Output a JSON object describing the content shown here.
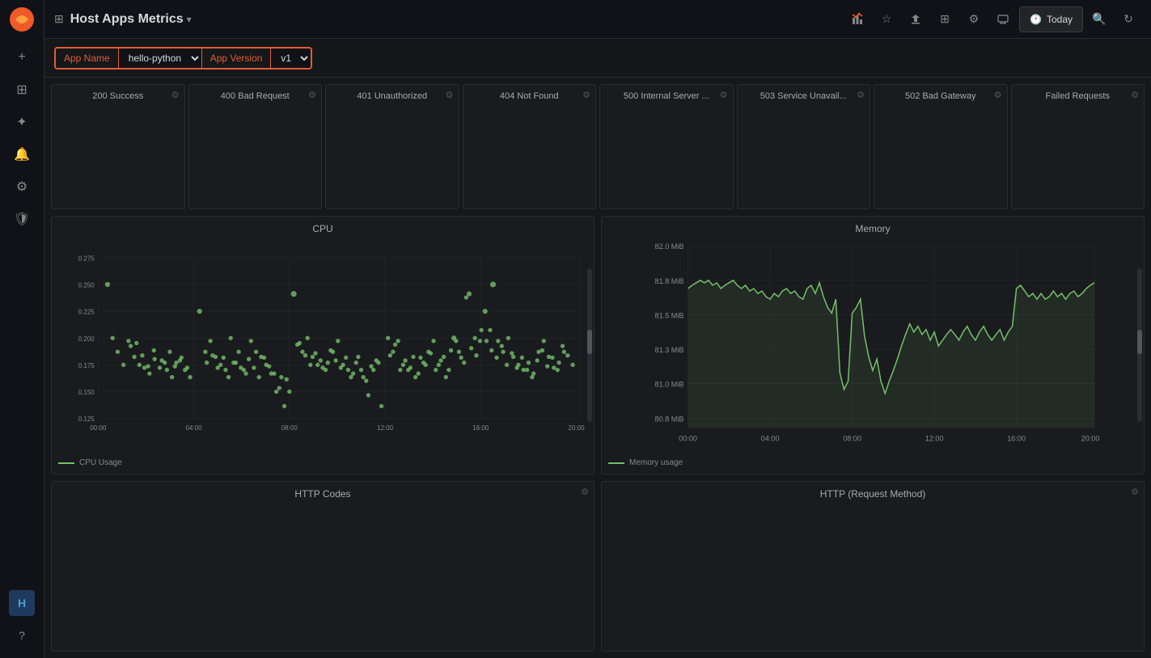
{
  "app": {
    "title": "Host Apps Metrics",
    "chevron": "▾"
  },
  "topbar": {
    "grid_icon": "⊞",
    "title": "Host Apps Metrics",
    "chevron": "▾",
    "today_label": "Today",
    "actions": {
      "bar_chart": "📊",
      "star": "☆",
      "share": "⎗",
      "grid": "⊞",
      "settings": "⚙",
      "monitor": "🖥",
      "search": "🔍",
      "refresh": "↻"
    }
  },
  "filters": {
    "app_name_label": "App Name",
    "app_name_value": "hello-python",
    "app_version_label": "App Version",
    "app_version_value": "v1"
  },
  "status_panels": [
    {
      "title": "200 Success"
    },
    {
      "title": "400 Bad Request"
    },
    {
      "title": "401 Unauthorized"
    },
    {
      "title": "404 Not Found"
    },
    {
      "title": "500 Internal Server ..."
    },
    {
      "title": "503 Service Unavail..."
    },
    {
      "title": "502 Bad Gateway"
    },
    {
      "title": "Failed Requests"
    }
  ],
  "cpu_chart": {
    "title": "CPU",
    "legend": "CPU Usage",
    "y_labels": [
      "0.275",
      "0.250",
      "0.225",
      "0.200",
      "0.175",
      "0.150",
      "0.125"
    ],
    "x_labels": [
      "00:00",
      "04:00",
      "08:00",
      "12:00",
      "16:00",
      "20:00"
    ]
  },
  "memory_chart": {
    "title": "Memory",
    "legend": "Memory usage",
    "y_labels": [
      "82.0 MiB",
      "81.8 MiB",
      "81.5 MiB",
      "81.3 MiB",
      "81.0 MiB",
      "80.8 MiB"
    ],
    "x_labels": [
      "00:00",
      "04:00",
      "08:00",
      "12:00",
      "16:00",
      "20:00"
    ]
  },
  "http_codes_chart": {
    "title": "HTTP Codes"
  },
  "http_method_chart": {
    "title": "HTTP (Request Method)"
  }
}
